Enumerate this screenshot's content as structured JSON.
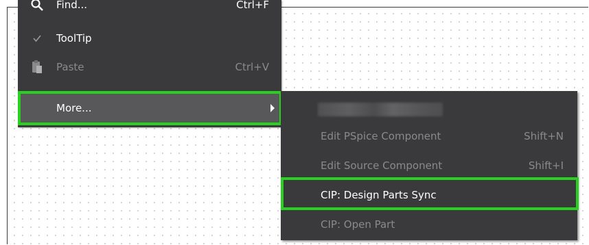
{
  "menu": {
    "find": {
      "label": "Find...",
      "shortcut": "Ctrl+F",
      "icon": "magnifier-icon"
    },
    "tooltip": {
      "label": "ToolTip",
      "icon": "checkmark-icon"
    },
    "paste": {
      "label": "Paste",
      "shortcut": "Ctrl+V",
      "icon": "clipboard-icon"
    },
    "more": {
      "label": "More...",
      "icon": "submenu-arrow-icon"
    }
  },
  "submenu": {
    "items": [
      {
        "label": "Edit PSpice Component",
        "shortcut": "Shift+N"
      },
      {
        "label": "Edit Source Component",
        "shortcut": "Shift+I"
      },
      {
        "label": "CIP: Design Parts Sync",
        "shortcut": ""
      },
      {
        "label": "CIP: Open Part",
        "shortcut": ""
      }
    ]
  },
  "colors": {
    "menu_bg": "#3a3a3c",
    "hover_bg": "#58585a",
    "highlight": "#28d11f",
    "disabled_text": "#8a8a8a"
  }
}
